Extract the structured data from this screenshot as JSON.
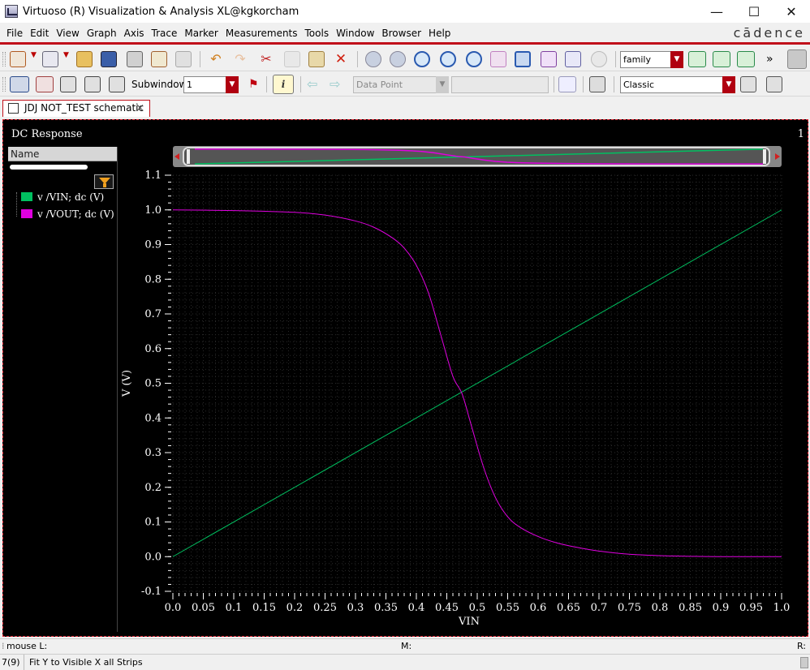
{
  "window": {
    "title": "Virtuoso (R) Visualization & Analysis XL@kgkorcham",
    "minimize": "—",
    "maximize": "☐",
    "close": "✕"
  },
  "menu": {
    "items": [
      "File",
      "Edit",
      "View",
      "Graph",
      "Axis",
      "Trace",
      "Marker",
      "Measurements",
      "Tools",
      "Window",
      "Browser",
      "Help"
    ],
    "brand": "cādence"
  },
  "toolbar1": {
    "family_combo": "family",
    "overflow": "»"
  },
  "toolbar2": {
    "subwindow_label": "Subwindow:",
    "subwindow_value": "1",
    "data_point_combo": "Data Point",
    "style_combo": "Classic",
    "info_glyph": "i"
  },
  "tab": {
    "label": "JDJ NOT_TEST schematic",
    "close": "×"
  },
  "graph": {
    "subwindow_title": "DC Response",
    "subwindow_number": "1",
    "legend_header": "Name",
    "traces": [
      {
        "label": "v /VIN; dc (V)",
        "color": "#00c060"
      },
      {
        "label": "v /VOUT; dc (V)",
        "color": "#e000e0"
      }
    ]
  },
  "chart_data": {
    "type": "line",
    "xlabel": "VIN",
    "ylabel": "V (V)",
    "xlim": [
      0.0,
      1.0
    ],
    "ylim": [
      -0.1,
      1.1
    ],
    "xticks": [
      "0.0",
      "0.05",
      "0.1",
      "0.15",
      "0.2",
      "0.25",
      "0.3",
      "0.35",
      "0.4",
      "0.45",
      "0.5",
      "0.55",
      "0.6",
      "0.65",
      "0.7",
      "0.75",
      "0.8",
      "0.85",
      "0.9",
      "0.95",
      "1.0"
    ],
    "yticks": [
      "1.1",
      "1.0",
      "0.9",
      "0.8",
      "0.7",
      "0.6",
      "0.5",
      "0.4",
      "0.3",
      "0.2",
      "0.1",
      "0.0",
      "-0.1"
    ],
    "grid": true,
    "series": [
      {
        "name": "v /VIN; dc (V)",
        "color": "#00c060",
        "x": [
          0.0,
          1.0
        ],
        "y": [
          0.0,
          1.0
        ]
      },
      {
        "name": "v /VOUT; dc (V)",
        "color": "#e000e0",
        "x": [
          0.0,
          0.1,
          0.2,
          0.25,
          0.3,
          0.33,
          0.36,
          0.38,
          0.4,
          0.42,
          0.44,
          0.46,
          0.475,
          0.49,
          0.51,
          0.53,
          0.55,
          0.57,
          0.6,
          0.63,
          0.66,
          0.7,
          0.75,
          0.8,
          0.85,
          0.9,
          1.0
        ],
        "y": [
          1.0,
          0.998,
          0.993,
          0.985,
          0.968,
          0.95,
          0.92,
          0.89,
          0.84,
          0.76,
          0.64,
          0.52,
          0.47,
          0.38,
          0.26,
          0.17,
          0.115,
          0.085,
          0.058,
          0.04,
          0.028,
          0.016,
          0.007,
          0.003,
          0.001,
          0.0,
          0.0
        ]
      }
    ]
  },
  "status": {
    "mouse_label": "mouse L:",
    "m_label": "M:",
    "r_label": "R:",
    "counter": "7(9)",
    "message": "Fit Y to Visible X all Strips"
  }
}
